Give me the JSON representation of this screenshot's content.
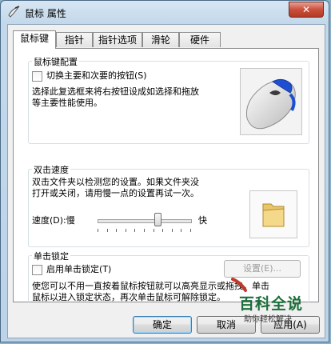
{
  "window": {
    "title": "鼠标 属性",
    "close_label": "✕"
  },
  "tabs": [
    {
      "label": "鼠标键",
      "active": true
    },
    {
      "label": "指针",
      "active": false
    },
    {
      "label": "指针选项",
      "active": false
    },
    {
      "label": "滑轮",
      "active": false
    },
    {
      "label": "硬件",
      "active": false
    }
  ],
  "button_config": {
    "group_title": "鼠标键配置",
    "checkbox_label": "切换主要和次要的按钮(S)",
    "checked": false,
    "description_line1": "选择此复选框来将右按钮设成如选择和拖放",
    "description_line2": "等主要性能使用。"
  },
  "double_click": {
    "group_title": "双击速度",
    "description_line1": "双击文件夹以检测您的设置。如果文件夹没",
    "description_line2": "打开或关闭，请用慢一点的设置再试一次。",
    "speed_label": "速度(D):慢",
    "speed_fast": "快",
    "speed_value": 0.65
  },
  "click_lock": {
    "group_title": "单击锁定",
    "checkbox_label": "启用单击锁定(T)",
    "checked": false,
    "settings_label": "设置(E)...",
    "description_line1": "使您可以不用一直按着鼠标按钮就可以高亮显示或拖拽。单击",
    "description_line2": "鼠标以进入锁定状态，再次单击鼠标可解除锁定。"
  },
  "footer": {
    "ok_label": "确定",
    "cancel_label": "取消",
    "apply_label": "应用(A)"
  },
  "watermark": {
    "title": "百科全说",
    "subtitle": "助你轻松解决"
  },
  "icons": {
    "title": "mouse-pointer-icon",
    "mouse": "mouse-image",
    "folder": "folder-icon"
  },
  "colors": {
    "accent": "#3c7fb1",
    "close_button": "#c9503c",
    "folder": "#e8c66a",
    "watermark": "#1c6e3a"
  }
}
